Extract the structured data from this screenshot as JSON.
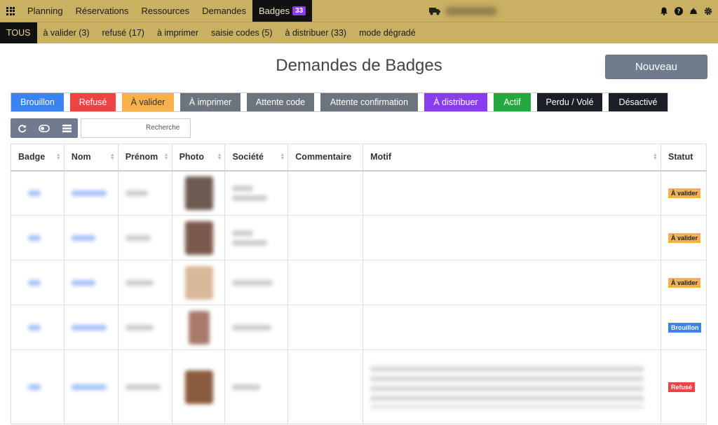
{
  "topnav": {
    "items": [
      "Planning",
      "Réservations",
      "Ressources",
      "Demandes",
      "Badges"
    ],
    "badge_count": "33"
  },
  "subnav": {
    "items": [
      "TOUS",
      "à valider (3)",
      "refusé (17)",
      "à imprimer",
      "saisie codes (5)",
      "à distribuer (33)",
      "mode dégradé"
    ]
  },
  "page": {
    "title": "Demandes de Badges",
    "new_button": "Nouveau"
  },
  "status_filters": [
    "Brouillon",
    "Refusé",
    "À valider",
    "À imprimer",
    "Attente code",
    "Attente confirmation",
    "À distribuer",
    "Actif",
    "Perdu / Volé",
    "Désactivé"
  ],
  "search": {
    "placeholder": "Recherche"
  },
  "table": {
    "headers": [
      "Badge",
      "Nom",
      "Prénom",
      "Photo",
      "Société",
      "Commentaire",
      "Motif",
      "Statut"
    ],
    "rows": [
      {
        "statut": "À valider",
        "status_color": "#f8b04a"
      },
      {
        "statut": "À valider",
        "status_color": "#f8b04a"
      },
      {
        "statut": "À valider",
        "status_color": "#f8b04a"
      },
      {
        "statut": "Brouillon",
        "status_color": "#3b82f6"
      },
      {
        "statut": "Refusé",
        "status_color": "#ee4444"
      }
    ]
  },
  "colors": {
    "navbar": "#c9b062",
    "active_nav": "#111111",
    "primary_button": "#717b8e"
  }
}
